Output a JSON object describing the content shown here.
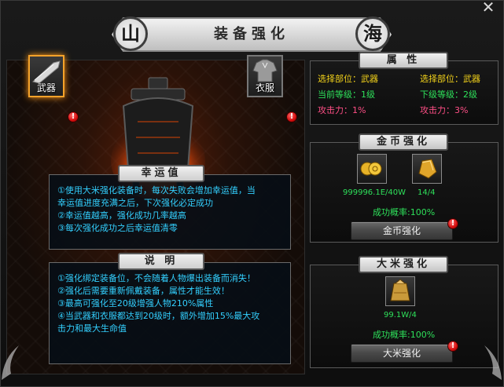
{
  "window": {
    "title": "装备强化",
    "close_glyph": "✕",
    "seal_left": "山",
    "seal_right": "海"
  },
  "slots": {
    "weapon_label": "武器",
    "armor_label": "衣服",
    "alert_glyph": "!"
  },
  "luck": {
    "title": "幸运值",
    "lines": [
      "①使用大米强化装备时，每次失败会增加幸运值，当",
      "幸运值进度充满之后，下次强化必定成功",
      "②幸运值越高，强化成功几率越高",
      "③每次强化成功之后幸运值清零"
    ]
  },
  "desc": {
    "title": "说 明",
    "lines": [
      "①强化绑定装备位，不会随着人物爆出装备而消失！",
      "②强化后需要重新佩戴装备，属性才能生效！",
      "③最高可强化至20级增强人物210%属性",
      "④当武器和衣服都达到20级时，额外增加15%最大攻",
      "击力和最大生命值"
    ]
  },
  "attributes": {
    "title": "属 性",
    "cur_part": "选择部位：武器",
    "next_part": "选择部位：武器",
    "cur_level": "当前等级：1级",
    "next_level": "下级等级：2级",
    "cur_attack": "攻击力：1%",
    "next_attack": "攻击力：3%"
  },
  "gold": {
    "title": "金币强化",
    "item1_count": "999996.1E/40W",
    "item2_count": "14/4",
    "success_rate": "成功概率:100%",
    "button": "金币强化"
  },
  "rice": {
    "title": "大米强化",
    "item_count": "99.1W/4",
    "success_rate": "成功概率:100%",
    "button": "大米强化"
  },
  "colors": {
    "info_text": "#33d0ff",
    "yellow_label": "#f3d21a",
    "green_label": "#2ee05a",
    "pink_label": "#ff4f86"
  },
  "icons": [
    "close-icon",
    "cauldron-icon",
    "weapon-blade-icon",
    "armor-icon",
    "gold-coins-icon",
    "gold-ingot-icon",
    "rice-bag-icon",
    "alert-icon"
  ]
}
